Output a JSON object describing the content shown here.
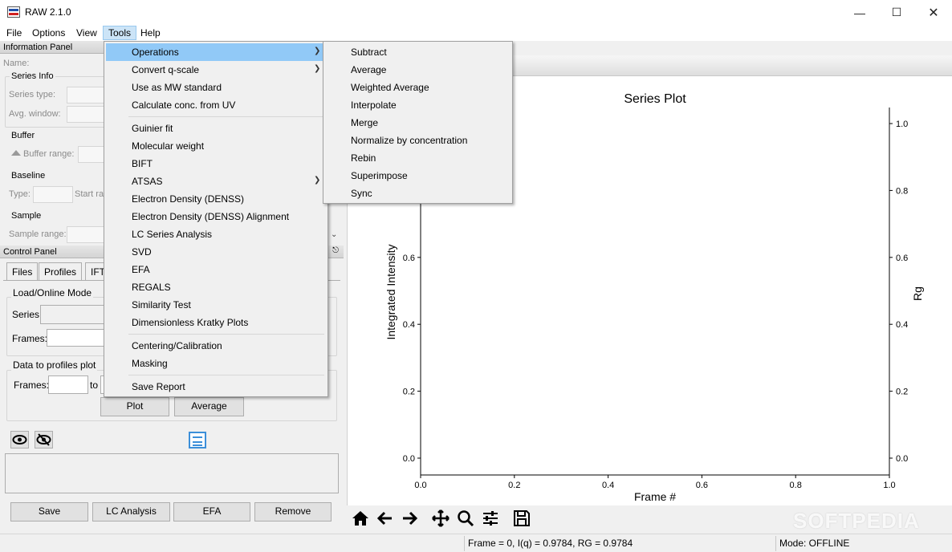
{
  "window": {
    "title": "RAW 2.1.0"
  },
  "menubar": {
    "items": [
      "File",
      "Options",
      "View",
      "Tools",
      "Help"
    ]
  },
  "info_panel": {
    "title": "Information Panel",
    "name_label": "Name:",
    "series_info": {
      "title": "Series Info",
      "series_type_label": "Series type:",
      "avg_window_label": "Avg. window:"
    },
    "buffer": {
      "title": "Buffer",
      "buffer_range_label": "Buffer range:"
    },
    "baseline": {
      "title": "Baseline",
      "type_label": "Type:",
      "start_label": "Start ra"
    },
    "sample": {
      "title": "Sample",
      "sample_range_label": "Sample range:"
    }
  },
  "control_panel": {
    "title": "Control Panel",
    "tabs": [
      "Files",
      "Profiles",
      "IFT"
    ],
    "load_mode": {
      "title": "Load/Online Mode",
      "series_label": "Series:",
      "frames_label": "Frames:"
    },
    "data_to_profiles": {
      "title": "Data to profiles plot",
      "frames_label": "Frames:",
      "to_label": "to",
      "plot_button": "Plot",
      "average_button": "Average"
    },
    "bottom_buttons": {
      "save": "Save",
      "lc_analysis": "LC Analysis",
      "efa": "EFA",
      "remove": "Remove"
    }
  },
  "tools_menu": {
    "items": [
      "Operations",
      "Convert q-scale",
      "Use as MW standard",
      "Calculate conc. from UV",
      "Guinier fit",
      "Molecular weight",
      "BIFT",
      "ATSAS",
      "Electron Density (DENSS)",
      "Electron Density (DENSS) Alignment",
      "LC Series Analysis",
      "SVD",
      "EFA",
      "REGALS",
      "Similarity Test",
      "Dimensionless Kratky Plots",
      "Centering/Calibration",
      "Masking",
      "Save Report"
    ]
  },
  "operations_menu": {
    "items": [
      "Subtract",
      "Average",
      "Weighted Average",
      "Interpolate",
      "Merge",
      "Normalize by concentration",
      "Rebin",
      "Superimpose",
      "Sync"
    ]
  },
  "chart_data": {
    "type": "line",
    "title": "Series Plot",
    "xlabel": "Frame #",
    "ylabel": "Integrated Intensity",
    "y2label": "Rg",
    "xlim": [
      0,
      1
    ],
    "ylim": [
      0,
      1
    ],
    "y2lim": [
      0,
      1
    ],
    "x_ticks": [
      "0.0",
      "0.2",
      "0.4",
      "0.6",
      "0.8",
      "1.0"
    ],
    "y_ticks": [
      "0.0",
      "0.2",
      "0.4",
      "0.6"
    ],
    "y2_ticks": [
      "0.0",
      "0.2",
      "0.4",
      "0.6",
      "0.8",
      "1.0"
    ],
    "series": []
  },
  "statusbar": {
    "readout": "Frame = 0, I(q) = 0.9784, RG = 0.9784",
    "mode": "Mode: OFFLINE"
  },
  "watermark": "SOFTPEDIA"
}
